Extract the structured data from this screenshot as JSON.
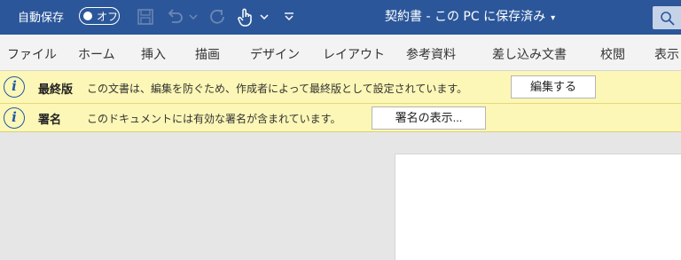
{
  "titlebar": {
    "autosave_label": "自動保存",
    "toggle_state": "オフ",
    "document_title": "契約書 - この PC に保存済み",
    "title_caret": "▾",
    "icons": [
      "save-icon",
      "undo-icon",
      "chevron-down-icon",
      "redo-icon",
      "touch-mode-icon",
      "chevron-down-icon",
      "customize-qat-icon",
      "search-icon"
    ]
  },
  "ribbon": {
    "tabs": [
      "ファイル",
      "ホーム",
      "挿入",
      "描画",
      "デザイン",
      "レイアウト",
      "参考資料",
      "差し込み文書",
      "校閲",
      "表示"
    ]
  },
  "messages": [
    {
      "icon": "info-icon",
      "title": "最終版",
      "text": "この文書は、編集を防ぐため、作成者によって最終版として設定されています。",
      "button": "編集する"
    },
    {
      "icon": "info-icon",
      "title": "署名",
      "text": "このドキュメントには有効な署名が含まれています。",
      "button": "署名の表示..."
    }
  ],
  "colors": {
    "titlebar": "#2b579a",
    "ribbon": "#f3f3f3",
    "message_bar": "#fcf7b6",
    "info_icon": "#1e5aa8",
    "canvas": "#e6e6e6",
    "page": "#ffffff"
  }
}
